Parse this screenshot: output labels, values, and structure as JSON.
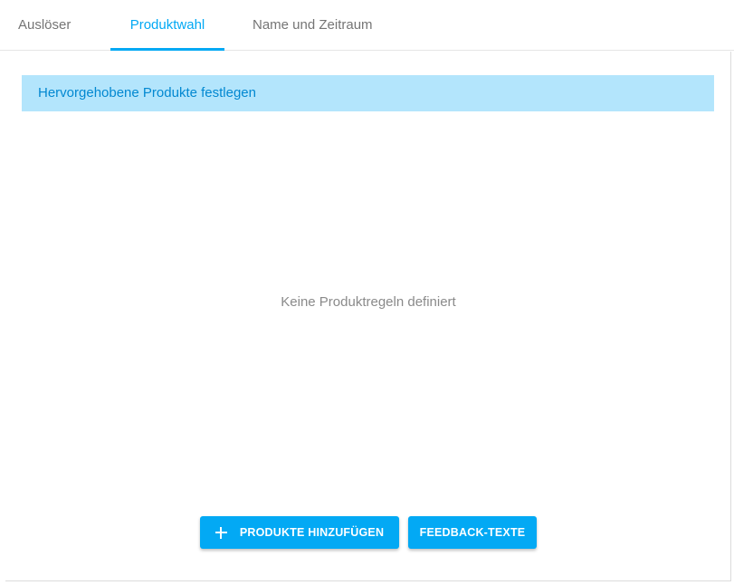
{
  "tabs": [
    {
      "label": "Auslöser",
      "active": false
    },
    {
      "label": "Produktwahl",
      "active": true
    },
    {
      "label": "Name und Zeitraum",
      "active": false
    }
  ],
  "panel": {
    "header": "Hervorgehobene Produkte festlegen",
    "empty_text": "Keine Produktregeln definiert"
  },
  "buttons": {
    "add_products": {
      "label": "PRODUKTE HINZUFÜGEN",
      "icon": "plus-icon"
    },
    "feedback_texts": {
      "label": "FEEDBACK-TEXTE"
    }
  },
  "colors": {
    "accent": "#03a9f4",
    "header_bg": "#b3e5fc",
    "header_text": "#0288d1",
    "muted_text": "#8a8a8a",
    "tab_text": "#757575"
  }
}
